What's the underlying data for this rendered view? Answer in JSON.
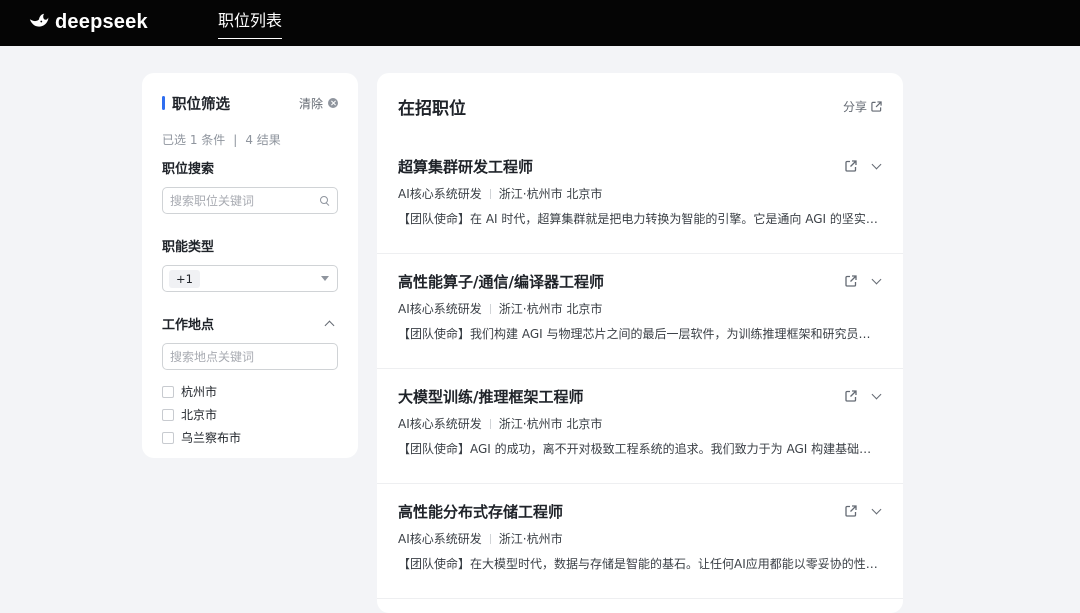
{
  "brand": {
    "name": "deepseek",
    "color": "#ffffff"
  },
  "nav": {
    "tab_label": "职位列表"
  },
  "filter": {
    "title": "职位筛选",
    "clear_label": "清除",
    "summary_selected": "已选 1 条件",
    "summary_sep": "|",
    "summary_results": "4 结果",
    "search_label": "职位搜索",
    "search_placeholder": "搜索职位关键词",
    "category_label": "职能类型",
    "category_chip": "+1",
    "location_label": "工作地点",
    "location_placeholder": "搜索地点关键词",
    "locations": [
      "杭州市",
      "北京市",
      "乌兰察布市"
    ],
    "accent_color": "#2f6ef0"
  },
  "jobs_panel": {
    "title": "在招职位",
    "share_label": "分享",
    "jobs": [
      {
        "title": "超算集群研发工程师",
        "department": "AI核心系统研发",
        "location": "浙江·杭州市 北京市",
        "description": "【团队使命】在 AI 时代，超算集群就是把电力转换为智能的引擎。它是通向 AGI 的坚实底座..."
      },
      {
        "title": "高性能算子/通信/编译器工程师",
        "department": "AI核心系统研发",
        "location": "浙江·杭州市 北京市",
        "description": "【团队使命】我们构建 AGI 与物理芯片之间的最后一层软件，为训练推理框架和研究员提供..."
      },
      {
        "title": "大模型训练/推理框架工程师",
        "department": "AI核心系统研发",
        "location": "浙江·杭州市 北京市",
        "description": "【团队使命】AGI 的成功，离不开对极致工程系统的追求。我们致力于为 AGI 构建基础设施..."
      },
      {
        "title": "高性能分布式存储工程师",
        "department": "AI核心系统研发",
        "location": "浙江·杭州市",
        "description": "【团队使命】在大模型时代，数据与存储是智能的基石。让任何AI应用都能以零妥协的性能和..."
      }
    ]
  }
}
